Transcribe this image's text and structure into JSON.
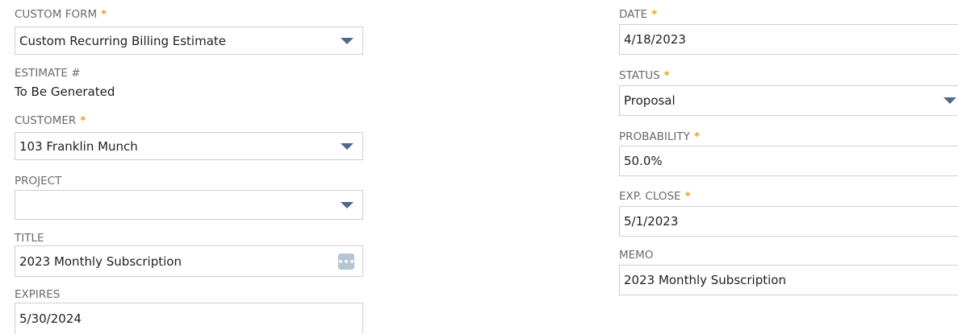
{
  "left": {
    "custom_form": {
      "label": "CUSTOM FORM",
      "value": "Custom Recurring Billing Estimate"
    },
    "estimate_no": {
      "label": "ESTIMATE #",
      "value": "To Be Generated"
    },
    "customer": {
      "label": "CUSTOMER",
      "value": "103 Franklin Munch"
    },
    "project": {
      "label": "PROJECT",
      "value": ""
    },
    "title": {
      "label": "TITLE",
      "value": "2023 Monthly Subscription"
    },
    "expires": {
      "label": "EXPIRES",
      "value": "5/30/2024"
    }
  },
  "right": {
    "date": {
      "label": "DATE",
      "value": "4/18/2023"
    },
    "status": {
      "label": "STATUS",
      "value": "Proposal"
    },
    "probability": {
      "label": "PROBABILITY",
      "value": "50.0%"
    },
    "exp_close": {
      "label": "EXP. CLOSE",
      "value": "5/1/2023"
    },
    "memo": {
      "label": "MEMO",
      "value": "2023 Monthly Subscription"
    }
  },
  "required_mark": "*",
  "icons": {
    "dropdown": "caret-down-icon",
    "more": "ellipsis-icon"
  },
  "colors": {
    "label": "#6a6a6a",
    "required": "#e0a51f",
    "caret": "#4d6a8e",
    "border": "#cfcfcf"
  }
}
